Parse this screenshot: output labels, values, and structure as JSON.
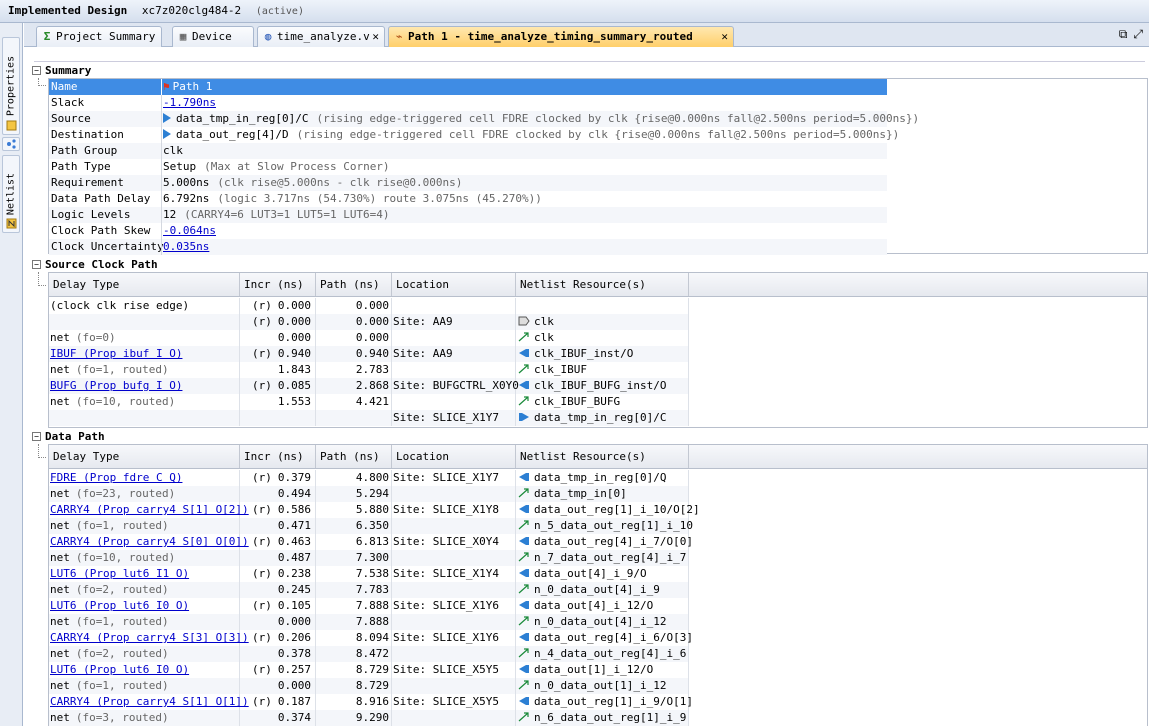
{
  "title": {
    "main": "Implemented Design",
    "part": "xc7z020clg484-2",
    "state": "(active)"
  },
  "side_tabs": [
    "Properties",
    "Netlist"
  ],
  "tabs": [
    {
      "label": "Project Summary",
      "icon": "sigma-icon",
      "active": false
    },
    {
      "label": "Device",
      "icon": "device-icon",
      "active": false
    },
    {
      "label": "time_analyze.v",
      "icon": "verilog-file-icon",
      "active": false
    },
    {
      "label": "Path 1 - time_analyze_timing_summary_routed",
      "icon": "timing-path-icon",
      "active": true
    }
  ],
  "summary": {
    "heading": "Summary",
    "rows": [
      {
        "key": "Name",
        "value": "Path 1",
        "note": ""
      },
      {
        "key": "Slack",
        "value": "-1.790ns",
        "note": ""
      },
      {
        "key": "Source",
        "value": "data_tmp_in_reg[0]/C",
        "note": "(rising edge-triggered cell FDRE clocked by clk  {rise@0.000ns fall@2.500ns period=5.000ns})"
      },
      {
        "key": "Destination",
        "value": "data_out_reg[4]/D",
        "note": "(rising edge-triggered cell FDRE clocked by clk  {rise@0.000ns fall@2.500ns period=5.000ns})"
      },
      {
        "key": "Path Group",
        "value": "clk",
        "note": ""
      },
      {
        "key": "Path Type",
        "value": "Setup",
        "note": "(Max at Slow Process Corner)"
      },
      {
        "key": "Requirement",
        "value": "5.000ns",
        "note": "(clk rise@5.000ns - clk rise@0.000ns)"
      },
      {
        "key": "Data Path Delay",
        "value": "6.792ns",
        "note": "(logic 3.717ns (54.730%)  route 3.075ns (45.270%))"
      },
      {
        "key": "Logic Levels",
        "value": "12",
        "note": "(CARRY4=6 LUT3=1 LUT5=1 LUT6=4)"
      },
      {
        "key": "Clock Path Skew",
        "value": "-0.064ns",
        "note": ""
      },
      {
        "key": "Clock Uncertainty",
        "value": "0.035ns",
        "note": ""
      }
    ]
  },
  "columns": [
    "Delay Type",
    "Incr (ns)",
    "Path (ns)",
    "Location",
    "Netlist Resource(s)"
  ],
  "source_clock": {
    "heading": "Source Clock Path",
    "rows": [
      {
        "type": "(clock clk rise edge)",
        "detail": "",
        "link": false,
        "r": "(r)",
        "incr": "0.000",
        "path": "0.000",
        "loc": "",
        "res": "",
        "icon": ""
      },
      {
        "type": "",
        "detail": "",
        "link": false,
        "r": "(r)",
        "incr": "0.000",
        "path": "0.000",
        "loc": "Site: AA9",
        "res": "clk",
        "icon": "port"
      },
      {
        "type": "net",
        "detail": "(fo=0)",
        "link": false,
        "r": "",
        "incr": "0.000",
        "path": "0.000",
        "loc": "",
        "res": "clk",
        "icon": "net"
      },
      {
        "type": "IBUF (Prop ibuf I O)",
        "detail": "",
        "link": true,
        "r": "(r)",
        "incr": "0.940",
        "path": "0.940",
        "loc": "Site: AA9",
        "res": "clk_IBUF_inst/O",
        "icon": "cell"
      },
      {
        "type": "net",
        "detail": "(fo=1, routed)",
        "link": false,
        "r": "",
        "incr": "1.843",
        "path": "2.783",
        "loc": "",
        "res": "clk_IBUF",
        "icon": "net"
      },
      {
        "type": "BUFG (Prop bufg I O)",
        "detail": "",
        "link": true,
        "r": "(r)",
        "incr": "0.085",
        "path": "2.868",
        "loc": "Site: BUFGCTRL_X0Y0",
        "res": "clk_IBUF_BUFG_inst/O",
        "icon": "cell"
      },
      {
        "type": "net",
        "detail": "(fo=10, routed)",
        "link": false,
        "r": "",
        "incr": "1.553",
        "path": "4.421",
        "loc": "",
        "res": "clk_IBUF_BUFG",
        "icon": "net"
      },
      {
        "type": "",
        "detail": "",
        "link": false,
        "r": "",
        "incr": "",
        "path": "",
        "loc": "Site: SLICE_X1Y7",
        "res": "data_tmp_in_reg[0]/C",
        "icon": "pin"
      }
    ]
  },
  "data_path": {
    "heading": "Data Path",
    "rows": [
      {
        "type": "FDRE (Prop fdre C Q)",
        "detail": "",
        "link": true,
        "r": "(r)",
        "incr": "0.379",
        "path": "4.800",
        "loc": "Site: SLICE_X1Y7",
        "res": "data_tmp_in_reg[0]/Q",
        "icon": "cell"
      },
      {
        "type": "net",
        "detail": "(fo=23, routed)",
        "link": false,
        "r": "",
        "incr": "0.494",
        "path": "5.294",
        "loc": "",
        "res": "data_tmp_in[0]",
        "icon": "net"
      },
      {
        "type": "CARRY4 (Prop carry4 S[1] O[2])",
        "detail": "",
        "link": true,
        "r": "(r)",
        "incr": "0.586",
        "path": "5.880",
        "loc": "Site: SLICE_X1Y8",
        "res": "data_out_reg[1]_i_10/O[2]",
        "icon": "cell"
      },
      {
        "type": "net",
        "detail": "(fo=1, routed)",
        "link": false,
        "r": "",
        "incr": "0.471",
        "path": "6.350",
        "loc": "",
        "res": "n_5_data_out_reg[1]_i_10",
        "icon": "net"
      },
      {
        "type": "CARRY4 (Prop carry4 S[0] O[0])",
        "detail": "",
        "link": true,
        "r": "(r)",
        "incr": "0.463",
        "path": "6.813",
        "loc": "Site: SLICE_X0Y4",
        "res": "data_out_reg[4]_i_7/O[0]",
        "icon": "cell"
      },
      {
        "type": "net",
        "detail": "(fo=10, routed)",
        "link": false,
        "r": "",
        "incr": "0.487",
        "path": "7.300",
        "loc": "",
        "res": "n_7_data_out_reg[4]_i_7",
        "icon": "net"
      },
      {
        "type": "LUT6 (Prop lut6 I1 O)",
        "detail": "",
        "link": true,
        "r": "(r)",
        "incr": "0.238",
        "path": "7.538",
        "loc": "Site: SLICE_X1Y4",
        "res": "data_out[4]_i_9/O",
        "icon": "cell"
      },
      {
        "type": "net",
        "detail": "(fo=2, routed)",
        "link": false,
        "r": "",
        "incr": "0.245",
        "path": "7.783",
        "loc": "",
        "res": "n_0_data_out[4]_i_9",
        "icon": "net"
      },
      {
        "type": "LUT6 (Prop lut6 I0 O)",
        "detail": "",
        "link": true,
        "r": "(r)",
        "incr": "0.105",
        "path": "7.888",
        "loc": "Site: SLICE_X1Y6",
        "res": "data_out[4]_i_12/O",
        "icon": "cell"
      },
      {
        "type": "net",
        "detail": "(fo=1, routed)",
        "link": false,
        "r": "",
        "incr": "0.000",
        "path": "7.888",
        "loc": "",
        "res": "n_0_data_out[4]_i_12",
        "icon": "net"
      },
      {
        "type": "CARRY4 (Prop carry4 S[3] O[3])",
        "detail": "",
        "link": true,
        "r": "(r)",
        "incr": "0.206",
        "path": "8.094",
        "loc": "Site: SLICE_X1Y6",
        "res": "data_out_reg[4]_i_6/O[3]",
        "icon": "cell"
      },
      {
        "type": "net",
        "detail": "(fo=2, routed)",
        "link": false,
        "r": "",
        "incr": "0.378",
        "path": "8.472",
        "loc": "",
        "res": "n_4_data_out_reg[4]_i_6",
        "icon": "net"
      },
      {
        "type": "LUT6 (Prop lut6 I0 O)",
        "detail": "",
        "link": true,
        "r": "(r)",
        "incr": "0.257",
        "path": "8.729",
        "loc": "Site: SLICE_X5Y5",
        "res": "data_out[1]_i_12/O",
        "icon": "cell"
      },
      {
        "type": "net",
        "detail": "(fo=1, routed)",
        "link": false,
        "r": "",
        "incr": "0.000",
        "path": "8.729",
        "loc": "",
        "res": "n_0_data_out[1]_i_12",
        "icon": "net"
      },
      {
        "type": "CARRY4 (Prop carry4 S[1] O[1])",
        "detail": "",
        "link": true,
        "r": "(r)",
        "incr": "0.187",
        "path": "8.916",
        "loc": "Site: SLICE_X5Y5",
        "res": "data_out_reg[1]_i_9/O[1]",
        "icon": "cell"
      },
      {
        "type": "net",
        "detail": "(fo=3, routed)",
        "link": false,
        "r": "",
        "incr": "0.374",
        "path": "9.290",
        "loc": "",
        "res": "n_6_data_out_reg[1]_i_9",
        "icon": "net"
      }
    ]
  },
  "colors": {
    "selection": "#3f8ce4",
    "link": "#0000cc",
    "active_tab": "#ffcf6a",
    "cell_icon": "#2c7fd3",
    "net_icon": "#1a8a3a"
  }
}
